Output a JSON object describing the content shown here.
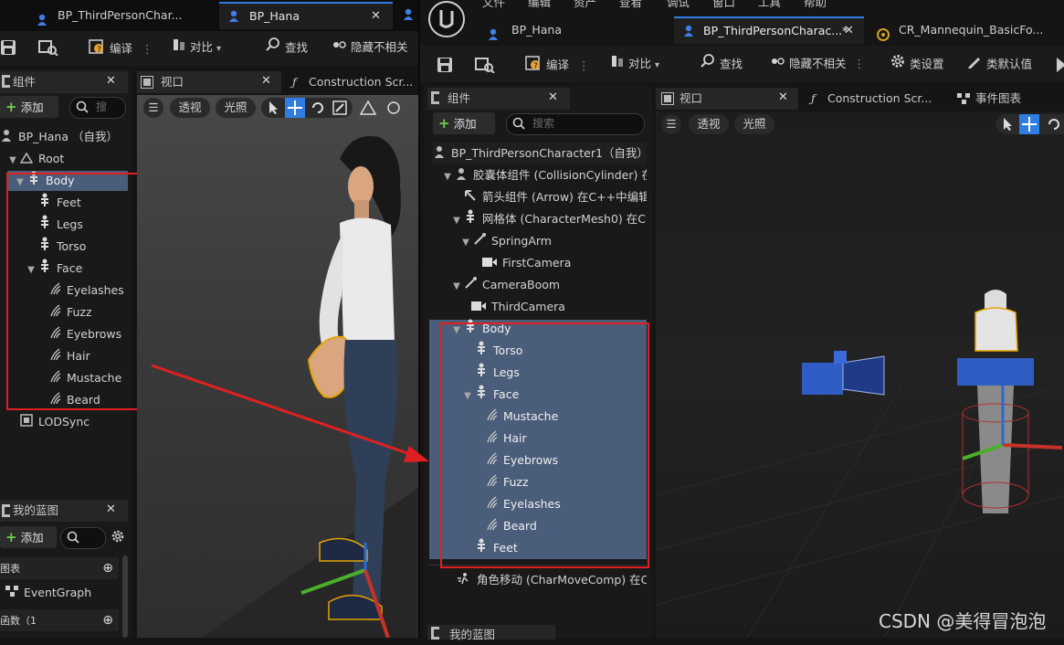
{
  "menu": [
    "文件",
    "编辑",
    "资产",
    "查看",
    "调试",
    "窗口",
    "工具",
    "帮助"
  ],
  "left_window": {
    "tabs": [
      {
        "label": "BP_ThirdPersonChar..."
      },
      {
        "label": "BP_Hana"
      }
    ],
    "toolbar": {
      "compile": "编译",
      "diff": "对比",
      "find": "查找",
      "hide_unrelated": "隐藏不相关"
    },
    "components_panel": {
      "title": "组件",
      "add_label": "添加",
      "search_placeholder": "搜",
      "tree": [
        {
          "label": "BP_Hana （自我）"
        },
        {
          "label": "Root"
        },
        {
          "label": "Body"
        },
        {
          "label": "Feet"
        },
        {
          "label": "Legs"
        },
        {
          "label": "Torso"
        },
        {
          "label": "Face"
        },
        {
          "label": "Eyelashes"
        },
        {
          "label": "Fuzz"
        },
        {
          "label": "Eyebrows"
        },
        {
          "label": "Hair"
        },
        {
          "label": "Mustache"
        },
        {
          "label": "Beard"
        },
        {
          "label": "LODSync"
        }
      ]
    },
    "my_blueprint": {
      "title": "我的蓝图",
      "add_label": "添加",
      "graphs_label": "图表",
      "event_graph": "EventGraph",
      "functions_label": "函数（1"
    },
    "viewport": {
      "tab_label": "视口",
      "construction_tab": "Construction Scr...",
      "perspective": "透视",
      "lit": "光照"
    }
  },
  "right_window": {
    "tabs": [
      {
        "label": "BP_Hana"
      },
      {
        "label": "BP_ThirdPersonCharac...*"
      },
      {
        "label": "CR_Mannequin_BasicFo..."
      }
    ],
    "toolbar": {
      "compile": "编译",
      "diff": "对比",
      "find": "查找",
      "hide_unrelated": "隐藏不相关",
      "class_settings": "类设置",
      "class_defaults": "类默认值"
    },
    "components_panel": {
      "title": "组件",
      "add_label": "添加",
      "search_placeholder": "搜索",
      "tree": [
        {
          "label": "BP_ThirdPersonCharacter1（自我）",
          "extra": ""
        },
        {
          "label": "胶囊体组件 (CollisionCylinder)",
          "extra": "在"
        },
        {
          "label": "箭头组件 (Arrow)",
          "extra": "在C++中编辑"
        },
        {
          "label": "网格体 (CharacterMesh0)",
          "extra": "在C"
        },
        {
          "label": "SpringArm",
          "extra": ""
        },
        {
          "label": "FirstCamera",
          "extra": ""
        },
        {
          "label": "CameraBoom",
          "extra": ""
        },
        {
          "label": "ThirdCamera",
          "extra": ""
        },
        {
          "label": "Body",
          "extra": ""
        },
        {
          "label": "Torso",
          "extra": ""
        },
        {
          "label": "Legs",
          "extra": ""
        },
        {
          "label": "Face",
          "extra": ""
        },
        {
          "label": "Mustache",
          "extra": ""
        },
        {
          "label": "Hair",
          "extra": ""
        },
        {
          "label": "Eyebrows",
          "extra": ""
        },
        {
          "label": "Fuzz",
          "extra": ""
        },
        {
          "label": "Eyelashes",
          "extra": ""
        },
        {
          "label": "Beard",
          "extra": ""
        },
        {
          "label": "Feet",
          "extra": ""
        },
        {
          "label": "角色移动 (CharMoveComp)",
          "extra": "在C"
        }
      ]
    },
    "viewport": {
      "tab_label": "视口",
      "construction_tab": "Construction Scr...",
      "event_graph_tab": "事件图表",
      "perspective": "透视",
      "lit": "光照"
    },
    "my_blueprint_title": "我的蓝图"
  },
  "watermark": "CSDN @美得冒泡泡",
  "colors": {
    "annotation_red": "#e02020",
    "selection_blue": "#4a5d7a",
    "tab_active_underline": "#2f7de1",
    "add_plus_green": "#6fcf4a"
  }
}
